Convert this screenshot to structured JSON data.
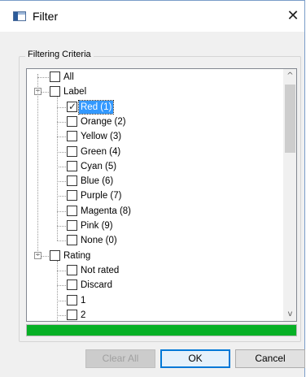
{
  "window": {
    "title": "Filter",
    "close_glyph": "✕"
  },
  "group": {
    "label": "Filtering Criteria"
  },
  "tree": {
    "all": "All",
    "label_group": "Label",
    "labels": [
      "Red (1)",
      "Orange (2)",
      "Yellow (3)",
      "Green (4)",
      "Cyan (5)",
      "Blue (6)",
      "Purple (7)",
      "Magenta (8)",
      "Pink (9)",
      "None (0)"
    ],
    "rating_group": "Rating",
    "ratings": [
      "Not rated",
      "Discard",
      "1",
      "2"
    ],
    "checked": [
      "Red (1)"
    ],
    "selected": "Red (1)"
  },
  "scrollbar": {
    "up_glyph": "^",
    "down_glyph": "v"
  },
  "progress": {
    "value_percent": 100,
    "color": "#06b025"
  },
  "buttons": {
    "clear_all": "Clear All",
    "ok": "OK",
    "cancel": "Cancel"
  },
  "icons": {
    "app": "filter-window-icon",
    "close": "close-icon",
    "tick": "checkmark-icon"
  }
}
